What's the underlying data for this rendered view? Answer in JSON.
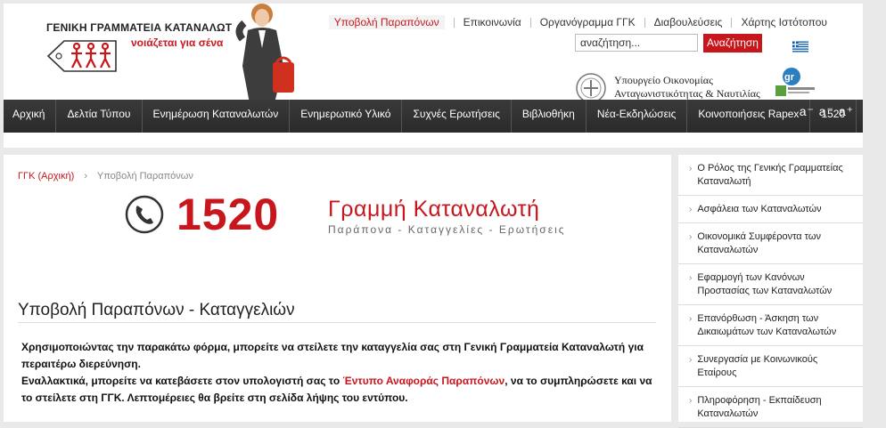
{
  "header": {
    "logo_title": "ΓΕΝΙΚΗ ΓΡΑΜΜΑΤΕΙΑ ΚΑΤΑΝΑΛΩΤΗ",
    "logo_sub": "νοιάζεται για σένα",
    "toplinks": [
      "Υποβολή Παραπόνων",
      "Επικοινωνία",
      "Οργανόγραμμα ΓΓΚ",
      "Διαβουλεύσεις",
      "Χάρτης Ιστότοπου"
    ],
    "search_placeholder": "αναζήτηση...",
    "search_button": "Αναζήτηση",
    "ministry_line1": "Υπουργείο Οικονομίας",
    "ministry_line2": "Ανταγωνιστικότητας & Ναυτιλίας"
  },
  "nav": {
    "items": [
      "Αρχική",
      "Δελτία Τύπου",
      "Ενημέρωση Καταναλωτών",
      "Ενημερωτικό Υλικό",
      "Συχνές Ερωτήσεις",
      "Βιβλιοθήκη",
      "Νέα-Εκδηλώσεις",
      "Κοινοποιήσεις Rapex",
      "1520"
    ],
    "font_size_controls": "a⁻ a⁼ a⁺"
  },
  "breadcrumb": {
    "home": "ΓΓΚ (Αρχική)",
    "current": "Υποβολή Παραπόνων"
  },
  "banner": {
    "number": "1520",
    "title": "Γραμμή Καταναλωτή",
    "subtitle": "Παράπονα - Καταγγελίες - Ερωτήσεις"
  },
  "page": {
    "title": "Υποβολή Παραπόνων - Καταγγελιών",
    "p1": "Χρησιμοποιώντας την παρακάτω φόρμα, μπορείτε να στείλετε την καταγγελία σας στη Γενική Γραμματεία Καταναλωτή για περαιτέρω διερεύνηση.",
    "p2_pre": "Εναλλακτικά, μπορείτε να κατεβάσετε στον υπολογιστή σας το ",
    "p2_link": "Έντυπο Αναφοράς Παραπόνων",
    "p2_post": ", να το συμπληρώσετε και να το στείλετε στη ΓΓΚ. Λεπτομέρειες θα βρείτε στη σελίδα λήψης του εντύπου."
  },
  "sidebar": {
    "items": [
      "Ο Ρόλος της Γενικής Γραμματείας Καταναλωτή",
      "Ασφάλεια των Καταναλωτών",
      "Οικονομικά Συμφέροντα των Καταναλωτών",
      "Εφαρμογή των Κανόνων Προστασίας των Καταναλωτών",
      "Επανόρθωση - Άσκηση των Δικαιωμάτων των Καταναλωτών",
      "Συνεργασία με Κοινωνικούς Εταίρους",
      "Πληροφόρηση - Εκπαίδευση Καταναλωτών"
    ]
  },
  "colors": {
    "accent": "#c8161d",
    "nav_bg": "#2f2f2f"
  }
}
